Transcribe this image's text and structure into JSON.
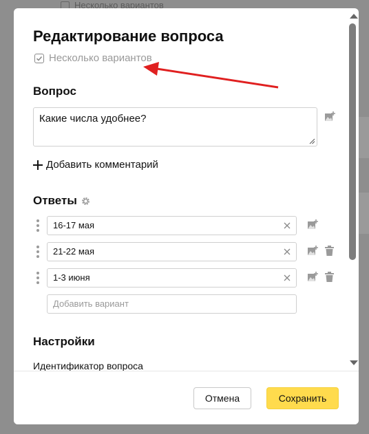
{
  "background": {
    "checkbox_label": "Несколько вариантов"
  },
  "dialog": {
    "title": "Редактирование вопроса",
    "multiple_choice_label": "Несколько вариантов",
    "question_section_title": "Вопрос",
    "question_text": "Какие числа удобнее?",
    "add_comment_label": "Добавить комментарий",
    "answers_section_title": "Ответы",
    "answers": [
      "16-17 мая",
      "21-22 мая",
      "1-3 июня"
    ],
    "add_option_placeholder": "Добавить вариант",
    "settings_section_title": "Настройки",
    "identifier_label": "Идентификатор вопроса",
    "cancel_label": "Отмена",
    "save_label": "Сохранить"
  },
  "colors": {
    "accent": "#ffdb4d",
    "annotation_arrow": "#e02020"
  }
}
